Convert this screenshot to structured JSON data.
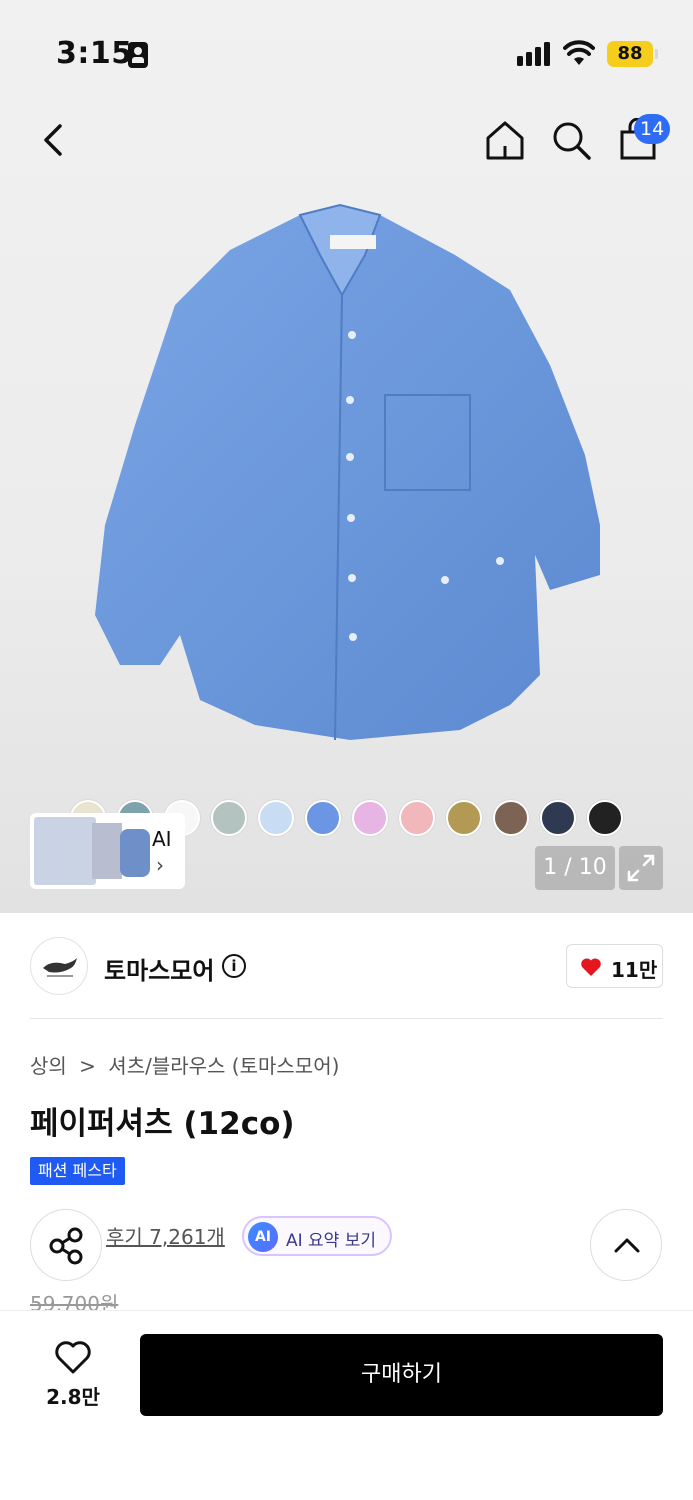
{
  "status_bar": {
    "time": "3:15",
    "battery": "88"
  },
  "header": {
    "cart_count": "14"
  },
  "gallery": {
    "swatches": [
      "#e9e3cf",
      "#7fa3ad",
      "#f7f7f7",
      "#b3c3c0",
      "#c8dcf3",
      "#6a96e3",
      "#e6b5e4",
      "#f1b7bb",
      "#b29a55",
      "#7c6354",
      "#2f3a52",
      "#222222"
    ],
    "ai_thumb_label": "AI",
    "ai_thumb_chevron": "›",
    "pager": "1 / 10"
  },
  "brand": {
    "name": "토마스모어",
    "info": "i",
    "likes": "11만"
  },
  "product": {
    "breadcrumb": [
      "상의",
      "셔츠/블라우스 (토마스모어)"
    ],
    "breadcrumb_sep": ">",
    "title": "페이퍼셔츠 (12co)",
    "badge": "패션 페스타",
    "reviews": "후기 7,261개",
    "ai_badge": "AI",
    "ai_summary": "AI 요약 보기",
    "original_price": "59,700원"
  },
  "bottom_bar": {
    "wishlist_count": "2.8만",
    "buy_label": "구매하기"
  },
  "colors": {
    "accent_blue": "#2f6cf6",
    "badge_blue": "#1f5bf3",
    "heart_red": "#e5161d",
    "shirt_blue": "#6a97db"
  }
}
